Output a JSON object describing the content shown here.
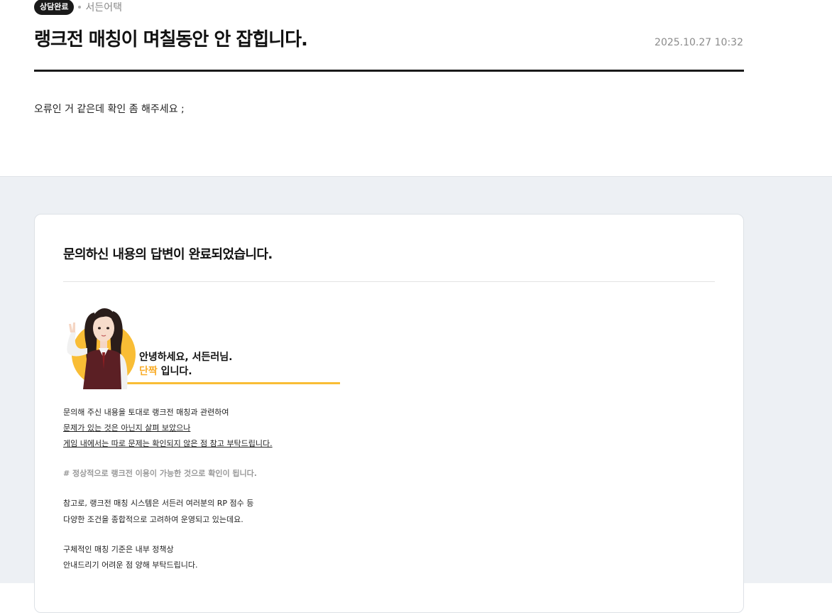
{
  "post": {
    "status_badge": "상담완료",
    "author": "서든어택",
    "title": "랭크전 매칭이 며칠동안 안 잡힙니다.",
    "date": "2025.10.27 10:32",
    "body": "오류인 거 같은데 확인 좀 해주세요 ;"
  },
  "answer": {
    "header": "문의하신 내용의 답변이 완료되었습니다.",
    "greeting_line1": "안녕하세요, 서든러님.",
    "greeting_name": "단짝",
    "greeting_suffix": " 입니다.",
    "lines": [
      "문의해 주신 내용을 토대로 랭크전 매칭과 관련하여",
      "문제가 있는 것은 아닌지 살펴 보았으나",
      "게임 내에서는 따로 문제는 확인되지 않은 점 참고 부탁드립니다.",
      "#  정상적으로 랭크전 이용이 가능한 것으로 확인이 됩니다.",
      "참고로, 랭크전 매칭 시스템은 서든러 여러분의 RP 점수 등",
      "다양한 조건을 종합적으로 고려하여 운영되고 있는데요.",
      "구체적인 매칭 기준은 내부 정책상",
      "안내드리기 어려운 점 양해 부탁드립니다."
    ]
  },
  "colors": {
    "accent": "#f9bd35",
    "name_highlight": "#f9ad2a",
    "background_lower": "#edf0f4"
  }
}
